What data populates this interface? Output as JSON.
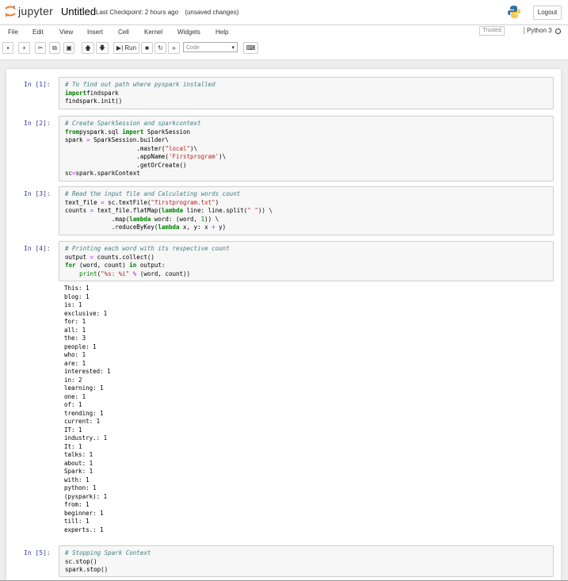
{
  "header": {
    "logo_text": "jupyter",
    "notebook_name": "Untitled",
    "checkpoint": "Last Checkpoint: 2 hours ago",
    "unsaved": "(unsaved changes)",
    "logout_label": "Logout"
  },
  "menu": [
    "File",
    "Edit",
    "View",
    "Insert",
    "Cell",
    "Kernel",
    "Widgets",
    "Help"
  ],
  "status": {
    "trusted": "Trusted",
    "kernel": "Python 3"
  },
  "toolbar": {
    "run_label": "Run",
    "cell_type": "Code"
  },
  "cells": [
    {
      "prompt": "In [1]:",
      "lines": [
        [
          [
            "c",
            "# To find out path where pyspark installed"
          ]
        ],
        [
          [
            "k",
            "import"
          ],
          [
            "",
            "findspark"
          ]
        ],
        [
          [
            "",
            "findspark.init()"
          ]
        ]
      ]
    },
    {
      "prompt": "In [2]:",
      "lines": [
        [
          [
            "c",
            "# Create SparkSession and sparkcontext"
          ]
        ],
        [
          [
            "k",
            "from"
          ],
          [
            "",
            "pyspark.sql "
          ],
          [
            "k",
            "import"
          ],
          [
            "",
            " SparkSession"
          ]
        ],
        [
          [
            "",
            "spark "
          ],
          [
            "o",
            "="
          ],
          [
            "",
            " SparkSession.builder\\"
          ]
        ],
        [
          [
            "",
            "                    .master("
          ],
          [
            "s",
            "\"local\""
          ],
          [
            "",
            ")\\"
          ]
        ],
        [
          [
            "",
            "                    .appName("
          ],
          [
            "s",
            "'Firstprogram'"
          ],
          [
            "",
            ")\\"
          ]
        ],
        [
          [
            "",
            "                    .getOrCreate()"
          ]
        ],
        [
          [
            "",
            "sc"
          ],
          [
            "o",
            "="
          ],
          [
            "",
            "spark.sparkContext"
          ]
        ]
      ]
    },
    {
      "prompt": "In [3]:",
      "lines": [
        [
          [
            "c",
            "# Read the input file and Calculating words count"
          ]
        ],
        [
          [
            "",
            "text_file "
          ],
          [
            "o",
            "="
          ],
          [
            "",
            " sc.textFile("
          ],
          [
            "s",
            "\"firstprogram.txt\""
          ],
          [
            "",
            ")"
          ]
        ],
        [
          [
            "",
            "counts "
          ],
          [
            "o",
            "="
          ],
          [
            "",
            " text_file.flatMap("
          ],
          [
            "k",
            "lambda"
          ],
          [
            "",
            " line: line.split("
          ],
          [
            "s",
            "\" \""
          ],
          [
            "",
            ")) \\"
          ]
        ],
        [
          [
            "",
            "             .map("
          ],
          [
            "k",
            "lambda"
          ],
          [
            "",
            " word: (word, "
          ],
          [
            "n",
            "1"
          ],
          [
            "",
            ")) \\"
          ]
        ],
        [
          [
            "",
            "             .reduceByKey("
          ],
          [
            "k",
            "lambda"
          ],
          [
            "",
            " x, y: x "
          ],
          [
            "o",
            "+"
          ],
          [
            "",
            " y)"
          ]
        ]
      ]
    },
    {
      "prompt": "In [4]:",
      "lines": [
        [
          [
            "c",
            "# Printing each word with its respective count"
          ]
        ],
        [
          [
            "",
            "output "
          ],
          [
            "o",
            "="
          ],
          [
            "",
            " counts.collect()"
          ]
        ],
        [
          [
            "k",
            "for"
          ],
          [
            "",
            " (word, count) "
          ],
          [
            "k",
            "in"
          ],
          [
            "",
            " output:"
          ]
        ],
        [
          [
            "",
            "    "
          ],
          [
            "n",
            "print"
          ],
          [
            "",
            "("
          ],
          [
            "s",
            "\"%s: %i\""
          ],
          [
            "",
            " "
          ],
          [
            "o",
            "%"
          ],
          [
            "",
            " (word, count))"
          ]
        ]
      ]
    },
    {
      "prompt": "In [5]:",
      "lines": [
        [
          [
            "c",
            "# Stopping Spark Context"
          ]
        ],
        [
          [
            "",
            "sc.stop()"
          ]
        ],
        [
          [
            "",
            "spark.stop()"
          ]
        ]
      ]
    }
  ],
  "output_lines": [
    "This: 1",
    "blog: 1",
    "is: 1",
    "exclusive: 1",
    "for: 1",
    "all: 1",
    "the: 3",
    "people: 1",
    "who: 1",
    "are: 1",
    "interested: 1",
    "in: 2",
    "learning: 1",
    "one: 1",
    "of: 1",
    "trending: 1",
    "current: 1",
    "IT: 1",
    "industry.: 1",
    "It: 1",
    "talks: 1",
    "about: 1",
    "Spark: 1",
    "with: 1",
    "python: 1",
    "(pyspark): 1",
    "from: 1",
    "beginner: 1",
    "till: 1",
    "experts.: 1"
  ]
}
